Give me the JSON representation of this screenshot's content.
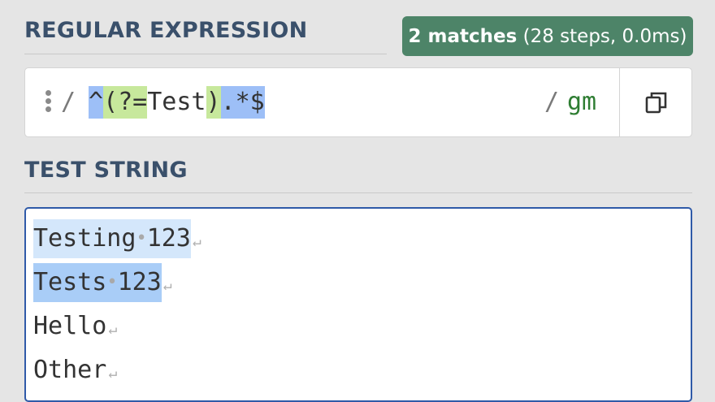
{
  "regex_section": {
    "title": "REGULAR EXPRESSION",
    "match_badge": {
      "count": "2 matches",
      "details": "(28 steps, 0.0ms)"
    },
    "delimiter_open": "/",
    "delimiter_close": "/",
    "flags": "gm",
    "pattern_tokens": [
      {
        "text": "^",
        "style": "blue"
      },
      {
        "text": "(?=",
        "style": "green"
      },
      {
        "text": "Test",
        "style": "plain"
      },
      {
        "text": ")",
        "style": "green"
      },
      {
        "text": ".*$",
        "style": "blue"
      }
    ]
  },
  "test_section": {
    "title": "TEST STRING",
    "lines": [
      {
        "before": "Testing",
        "space": "•",
        "after": "123",
        "newline": "↵",
        "match": "light"
      },
      {
        "before": "Tests",
        "space": "•",
        "after": "123",
        "newline": "↵",
        "match": "strong"
      },
      {
        "before": "Hello",
        "space": "",
        "after": "",
        "newline": "↵",
        "match": "none"
      },
      {
        "before": "Other",
        "space": "",
        "after": "",
        "newline": "↵",
        "match": "none"
      }
    ]
  },
  "colors": {
    "title": "#3a506b",
    "badge": "#4d8468",
    "regex_anchor_bg": "#9dbff7",
    "regex_group_bg": "#c7e89c",
    "match_light_bg": "#d4e7fb",
    "match_strong_bg": "#a9cdf7",
    "flags": "#2e7d32",
    "test_border": "#2f5aa8"
  },
  "icons": {
    "drag": "drag-handle-icon",
    "copy": "copy-icon"
  }
}
